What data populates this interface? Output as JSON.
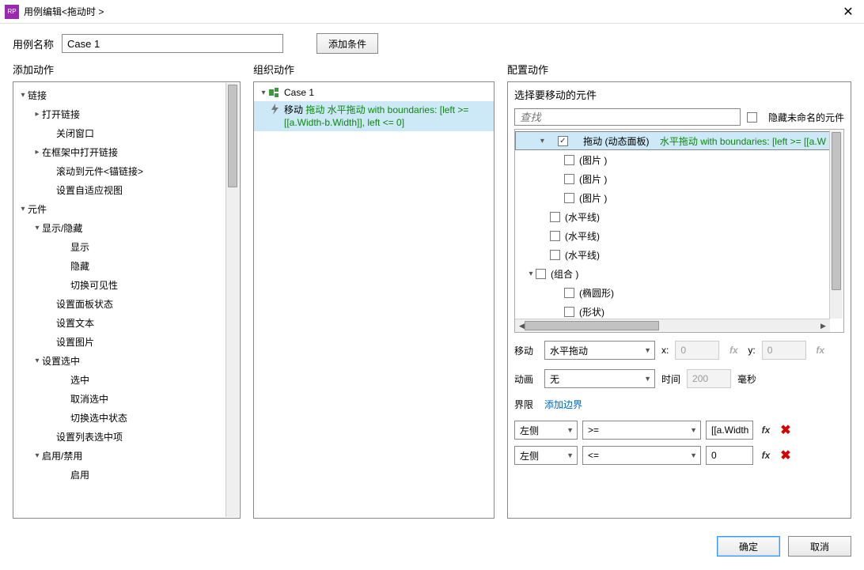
{
  "titlebar": {
    "title": "用例编辑<拖动时 >",
    "icon_text": "RP"
  },
  "toprow": {
    "name_label": "用例名称",
    "name_value": "Case 1",
    "add_condition": "添加条件"
  },
  "columns": {
    "left": "添加动作",
    "mid": "组织动作",
    "right": "配置动作"
  },
  "actions_tree": [
    {
      "label": "链接",
      "type": "open",
      "indent": 0
    },
    {
      "label": "打开链接",
      "type": "closed",
      "indent": 1
    },
    {
      "label": "关闭窗口",
      "type": "none",
      "indent": 2
    },
    {
      "label": "在框架中打开链接",
      "type": "closed",
      "indent": 1
    },
    {
      "label": "滚动到元件<锚链接>",
      "type": "none",
      "indent": 2
    },
    {
      "label": "设置自适应视图",
      "type": "none",
      "indent": 2
    },
    {
      "label": "元件",
      "type": "open",
      "indent": 0
    },
    {
      "label": "显示/隐藏",
      "type": "open",
      "indent": 1
    },
    {
      "label": "显示",
      "type": "none",
      "indent": 3
    },
    {
      "label": "隐藏",
      "type": "none",
      "indent": 3
    },
    {
      "label": "切换可见性",
      "type": "none",
      "indent": 3
    },
    {
      "label": "设置面板状态",
      "type": "none",
      "indent": 2
    },
    {
      "label": "设置文本",
      "type": "none",
      "indent": 2
    },
    {
      "label": "设置图片",
      "type": "none",
      "indent": 2
    },
    {
      "label": "设置选中",
      "type": "open",
      "indent": 1
    },
    {
      "label": "选中",
      "type": "none",
      "indent": 3
    },
    {
      "label": "取消选中",
      "type": "none",
      "indent": 3
    },
    {
      "label": "切换选中状态",
      "type": "none",
      "indent": 3
    },
    {
      "label": "设置列表选中项",
      "type": "none",
      "indent": 2
    },
    {
      "label": "启用/禁用",
      "type": "open",
      "indent": 1
    },
    {
      "label": "启用",
      "type": "none",
      "indent": 3
    }
  ],
  "organize": {
    "case_label": "Case 1",
    "action_prefix": "移动 ",
    "action_green": "拖动 水平拖动 with boundaries: [left >= [[a.Width-b.Width]], left <= 0]"
  },
  "config": {
    "select_title": "选择要移动的元件",
    "search_placeholder": "查找",
    "hide_unnamed": "隐藏未命名的元件",
    "tree": [
      {
        "indent": 0,
        "tri": "open",
        "checked": true,
        "label": "拖动 (动态面板) ",
        "green": "水平拖动 with boundaries: [left >= [[a.W",
        "sel": true
      },
      {
        "indent": 2,
        "tri": "none",
        "checked": false,
        "label": "(图片 )"
      },
      {
        "indent": 2,
        "tri": "none",
        "checked": false,
        "label": "(图片 )"
      },
      {
        "indent": 2,
        "tri": "none",
        "checked": false,
        "label": "(图片 )"
      },
      {
        "indent": 1,
        "tri": "none",
        "checked": false,
        "label": "(水平线)"
      },
      {
        "indent": 1,
        "tri": "none",
        "checked": false,
        "label": "(水平线)"
      },
      {
        "indent": 1,
        "tri": "none",
        "checked": false,
        "label": "(水平线)"
      },
      {
        "indent": 0,
        "tri": "open",
        "checked": false,
        "label": "(组合 )"
      },
      {
        "indent": 2,
        "tri": "none",
        "checked": false,
        "label": "(椭圆形)"
      },
      {
        "indent": 2,
        "tri": "none",
        "checked": false,
        "label": "(形状)"
      }
    ],
    "move": {
      "label": "移动",
      "type": "水平拖动",
      "x_label": "x:",
      "x": "0",
      "y_label": "y:",
      "y": "0"
    },
    "anim": {
      "label": "动画",
      "type": "无",
      "time_label": "时间",
      "time": "200",
      "unit": "毫秒"
    },
    "bounds": {
      "label": "界限",
      "add": "添加边界"
    },
    "bound_rows": [
      {
        "side": "左侧",
        "op": ">=",
        "val": "[[a.Width"
      },
      {
        "side": "左侧",
        "op": "<=",
        "val": "0"
      }
    ],
    "fx_label": "fx"
  },
  "footer": {
    "ok": "确定",
    "cancel": "取消"
  }
}
